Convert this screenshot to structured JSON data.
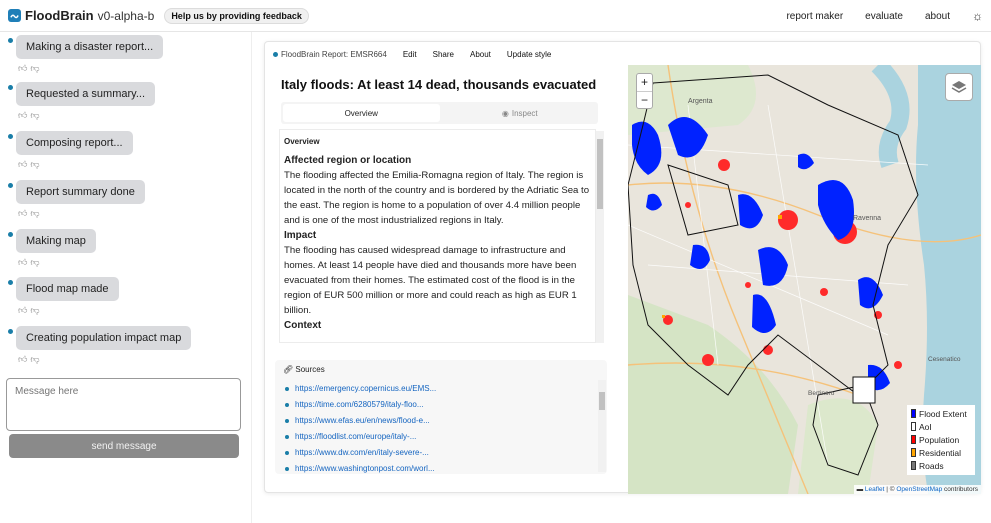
{
  "app": {
    "name": "FloodBrain",
    "version": "v0-alpha-b",
    "feedback_badge": "Help us by providing feedback"
  },
  "nav": {
    "items": [
      "report maker",
      "evaluate",
      "about"
    ]
  },
  "chat": {
    "messages": [
      {
        "text": "Making a disaster report..."
      },
      {
        "text": "Requested a summary..."
      },
      {
        "text": "Composing report..."
      },
      {
        "text": "Report summary done"
      },
      {
        "text": "Making map"
      },
      {
        "text": "Flood map made"
      },
      {
        "text": "Creating population impact map"
      }
    ],
    "input_placeholder": "Message here",
    "send_label": "send message"
  },
  "panel": {
    "report_title": "FloodBrain Report: EMSR664",
    "menu": [
      "Edit",
      "Share",
      "About",
      "Update style"
    ]
  },
  "report": {
    "headline": "Italy floods: At least 14 dead, thousands evacuated",
    "tabs": {
      "overview": "Overview",
      "inspect": "Inspect"
    },
    "overview_label": "Overview",
    "sections": [
      {
        "heading": "Affected region or location",
        "text": "The flooding affected the Emilia-Romagna region of Italy. The region is located in the north of the country and is bordered by the Adriatic Sea to the east. The region is home to a population of over 4.4 million people and is one of the most industrialized regions in Italy."
      },
      {
        "heading": "Impact",
        "text": "The flooding has caused widespread damage to infrastructure and homes. At least 14 people have died and thousands more have been evacuated from their homes. The estimated cost of the flood is in the region of EUR 500 million or more and could reach as high as EUR 1 billion."
      },
      {
        "heading": "Context",
        "text": ""
      }
    ],
    "sources_title": "Sources",
    "sources": [
      "https://emergency.copernicus.eu/EMS...",
      "https://time.com/6280579/italy-floo...",
      "https://www.efas.eu/en/news/flood-e...",
      "https://floodlist.com/europe/italy-...",
      "https://www.dw.com/en/italy-severe-...",
      "https://www.washingtonpost.com/worl..."
    ]
  },
  "map": {
    "zoom_in": "+",
    "zoom_out": "−",
    "legend": [
      {
        "label": "Flood Extent",
        "color": "#0000ff"
      },
      {
        "label": "AoI",
        "color": "#ffffff"
      },
      {
        "label": "Population",
        "color": "#ff0000"
      },
      {
        "label": "Residential",
        "color": "#ffa500"
      },
      {
        "label": "Roads",
        "color": "#777777"
      }
    ],
    "attribution_leaflet": "Leaflet",
    "attribution_sep": "| ©",
    "attribution_osm": "OpenStreetMap",
    "attribution_tail": "contributors",
    "place_labels": [
      "Argenta",
      "Ravenna",
      "Bertinoro",
      "Cesenatico"
    ]
  }
}
